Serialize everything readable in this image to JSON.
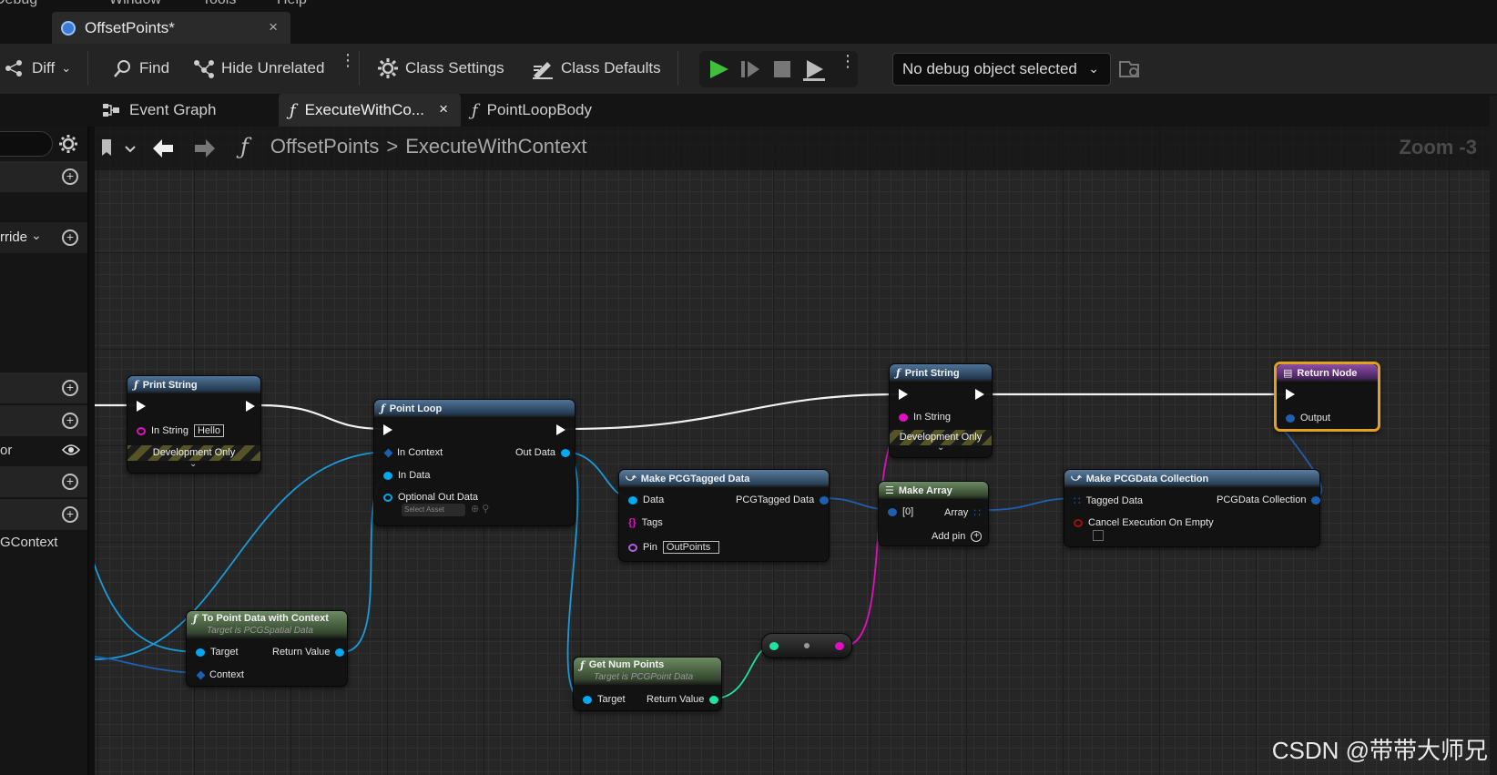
{
  "menu": {
    "partial_left": "Debug",
    "partial_window": "Window",
    "partial_tools": "Tools",
    "partial_help": "Help"
  },
  "document_tab": {
    "title": "OffsetPoints*",
    "close": "×"
  },
  "toolbar": {
    "diff": "Diff",
    "find": "Find",
    "hide_unrelated": "Hide Unrelated",
    "class_settings": "Class Settings",
    "class_defaults": "Class Defaults",
    "debug_object": "No debug object selected"
  },
  "graph_tabs": [
    {
      "label": "Event Graph"
    },
    {
      "label": "ExecuteWithCo...",
      "close": "×"
    },
    {
      "label": "PointLoopBody"
    }
  ],
  "breadcrumb": {
    "root": "OffsetPoints",
    "separator": ">",
    "current": "ExecuteWithContext"
  },
  "zoom": "Zoom -3",
  "left_panel": {
    "override": "rride",
    "item_or": "or",
    "item_context": "GContext"
  },
  "nodes": {
    "print_string_1": {
      "title": "Print String",
      "in_string": "In String",
      "value": "Hello",
      "dev_only": "Development Only"
    },
    "point_loop": {
      "title": "Point Loop",
      "in_context": "In Context",
      "in_data": "In Data",
      "optional_out": "Optional Out Data",
      "select_asset": "Select Asset",
      "out_data": "Out Data"
    },
    "make_tagged": {
      "title": "Make PCGTagged Data",
      "data": "Data",
      "tags": "Tags",
      "pin": "Pin",
      "pin_value": "OutPoints",
      "out": "PCGTagged Data"
    },
    "print_string_2": {
      "title": "Print String",
      "in_string": "In String",
      "dev_only": "Development Only"
    },
    "make_array": {
      "title": "Make Array",
      "index0": "[0]",
      "array": "Array",
      "add_pin": "Add pin"
    },
    "make_collection": {
      "title": "Make PCGData Collection",
      "tagged": "Tagged Data",
      "cancel": "Cancel Execution On Empty",
      "out": "PCGData Collection"
    },
    "return_node": {
      "title": "Return Node",
      "output": "Output"
    },
    "to_point": {
      "title": "To Point Data with Context",
      "subtitle": "Target is PCGSpatial Data",
      "target": "Target",
      "context": "Context",
      "ret": "Return Value"
    },
    "get_num": {
      "title": "Get Num Points",
      "subtitle": "Target is PCGPoint Data",
      "target": "Target",
      "ret": "Return Value"
    }
  },
  "colors": {
    "exec": "#ffffff",
    "object": "#00a8f0",
    "string": "#ff00d0",
    "integer": "#1ee3a6",
    "struct": "#0066cc",
    "return_border": "#e0a020"
  },
  "watermark": "CSDN @带带大师兄"
}
